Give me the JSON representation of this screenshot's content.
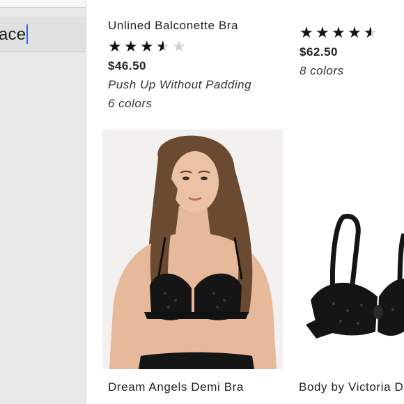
{
  "search": {
    "query_visible": "ace"
  },
  "products": [
    {
      "name": "Unlined Balconette Bra",
      "rating": 3.5,
      "rating_max": 5,
      "price": "$46.50",
      "description": "Push Up Without Padding",
      "colors": "6 colors"
    },
    {
      "name": "",
      "rating": 4.5,
      "rating_max": 5,
      "price": "$62.50",
      "colors": "8 colors"
    },
    {
      "name": "Dream Angels Demi Bra",
      "image": "model-wearing-black-lace-bra"
    },
    {
      "name": "Body by Victoria D",
      "image": "black-lace-bra-product-shot"
    }
  ],
  "colors": {
    "panel_bg": "#e9e9e9",
    "caret": "#3a64e8",
    "star_filled": "#111111",
    "star_empty": "#d2d2d2"
  }
}
